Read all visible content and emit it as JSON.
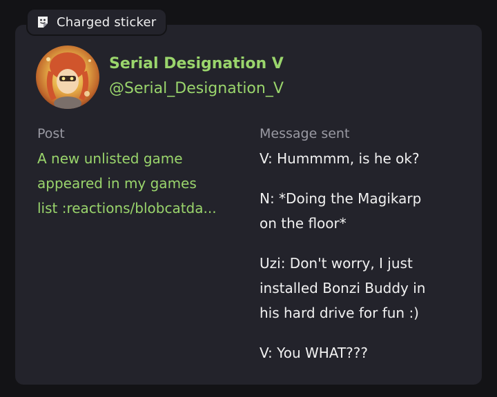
{
  "badge": {
    "label": "Charged sticker",
    "icon": "sticker-icon"
  },
  "author": {
    "display_name": "Serial Designation V",
    "handle": "@Serial_Designation_V",
    "avatar_icon": "avatar"
  },
  "post": {
    "label": "Post",
    "text": "A new unlisted game\nappeared in my games\nlist :reactions/blobcatda..."
  },
  "message": {
    "label": "Message sent",
    "lines": [
      "V: Hummmm, is he ok?",
      "N: *Doing the Magikarp\non the floor*",
      "Uzi: Don't worry, I just\ninstalled Bonzi Buddy in\nhis hard drive for fun :)",
      "V: You WHAT???"
    ]
  },
  "colors": {
    "background": "#131316",
    "card": "#23232b",
    "accent_green": "#9ad56c",
    "text": "#f1f1f1",
    "muted": "#9a9aa3"
  }
}
